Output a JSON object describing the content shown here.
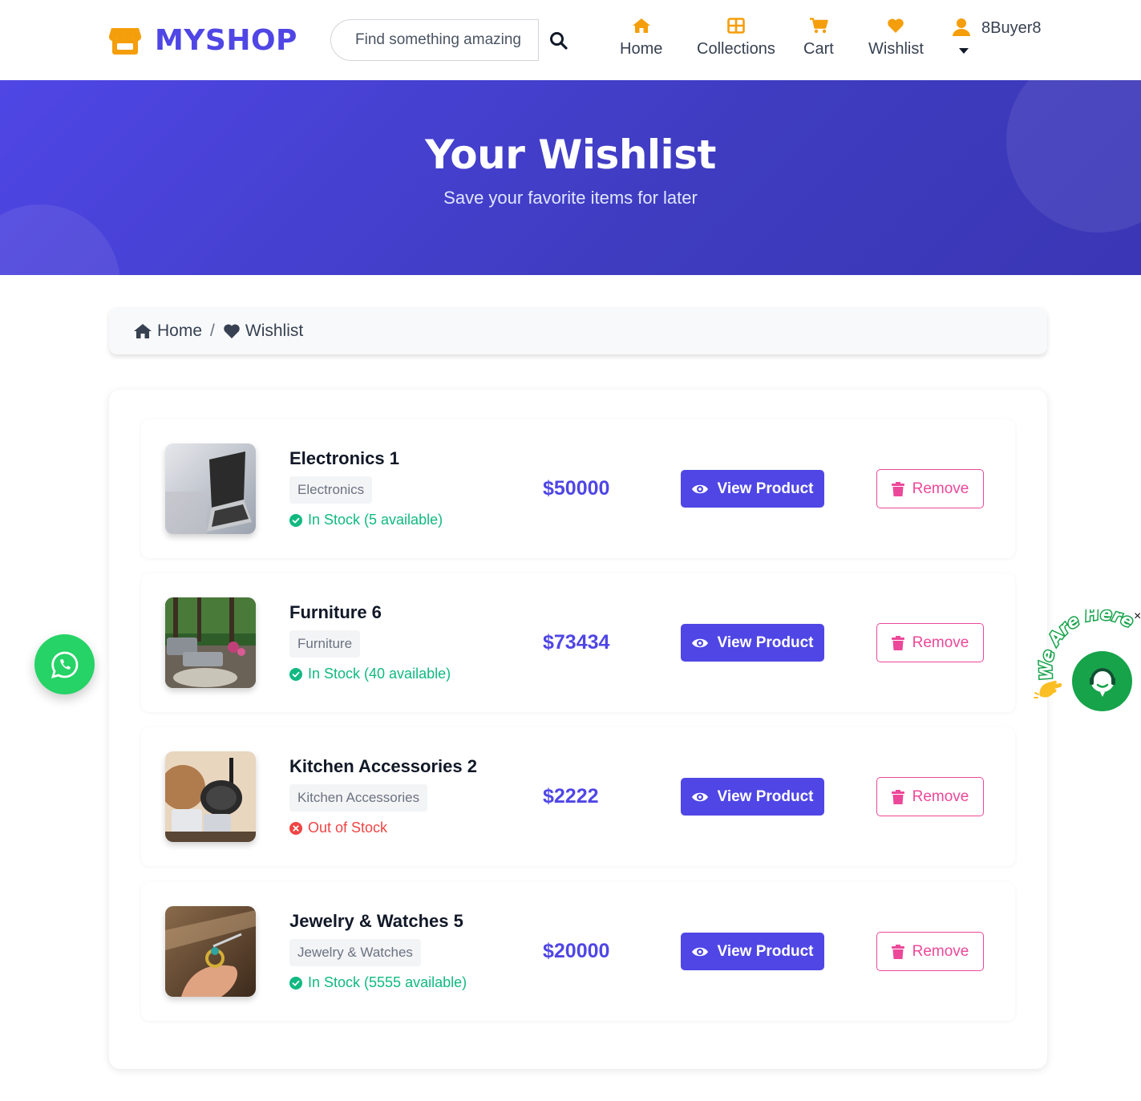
{
  "brand": {
    "name": "MYSHOP"
  },
  "search": {
    "placeholder": "Find something amazing"
  },
  "nav": {
    "home": "Home",
    "collections": "Collections",
    "cart": "Cart",
    "wishlist": "Wishlist",
    "user": "8Buyer8"
  },
  "hero": {
    "title": "Your Wishlist",
    "subtitle": "Save your favorite items for later"
  },
  "breadcrumb": {
    "home": "Home",
    "separator": "/",
    "current": "Wishlist"
  },
  "items": [
    {
      "name": "Electronics 1",
      "category": "Electronics",
      "stock": "In Stock (5 available)",
      "in_stock": true,
      "price": "$50000",
      "view": "View Product",
      "remove": "Remove",
      "image": "laptop"
    },
    {
      "name": "Furniture 6",
      "category": "Furniture",
      "stock": "In Stock (40 available)",
      "in_stock": true,
      "price": "$73434",
      "view": "View Product",
      "remove": "Remove",
      "image": "outdoor-furniture"
    },
    {
      "name": "Kitchen Accessories 2",
      "category": "Kitchen Accessories",
      "stock": "Out of Stock",
      "in_stock": false,
      "price": "$2222",
      "view": "View Product",
      "remove": "Remove",
      "image": "cookware"
    },
    {
      "name": "Jewelry & Watches 5",
      "category": "Jewelry & Watches",
      "stock": "In Stock (5555 available)",
      "in_stock": true,
      "price": "$20000",
      "view": "View Product",
      "remove": "Remove",
      "image": "ring"
    }
  ],
  "widgets": {
    "chat_label": "We Are Here",
    "chat_close": "×"
  },
  "colors": {
    "brand": "#4f46e5",
    "accent_orange": "#f59e0b",
    "in_stock": "#10b981",
    "out_of_stock": "#ef4444",
    "remove": "#ec4899",
    "whatsapp": "#25d366"
  }
}
